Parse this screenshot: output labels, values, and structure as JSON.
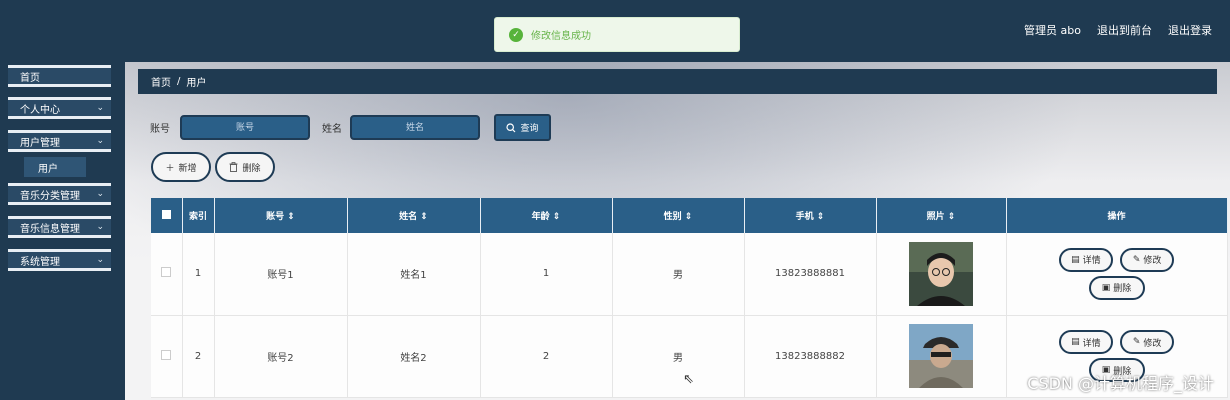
{
  "toast": {
    "message": "修改信息成功",
    "icon": "check-circle-icon",
    "color": "#67b44a"
  },
  "header": {
    "user": "管理员 abo",
    "to_front": "退出到前台",
    "logout": "退出登录"
  },
  "sidebar": {
    "items": [
      {
        "label": "首页",
        "chevron": ""
      },
      {
        "label": "个人中心",
        "chevron": "⌄"
      },
      {
        "label": "用户管理",
        "chevron": "⌄"
      },
      {
        "label": "音乐分类管理",
        "chevron": "⌄"
      },
      {
        "label": "音乐信息管理",
        "chevron": "⌄"
      },
      {
        "label": "系统管理",
        "chevron": "⌄"
      }
    ],
    "sub_item": "用户"
  },
  "breadcrumb": {
    "home": "首页",
    "sep": "/",
    "current": "用户"
  },
  "search": {
    "account_label": "账号",
    "account_placeholder": "账号",
    "name_label": "姓名",
    "name_placeholder": "姓名",
    "query_label": "查询"
  },
  "actions": {
    "add_label": "新增",
    "delete_label": "删除"
  },
  "table": {
    "headers": [
      "索引",
      "账号 ⇕",
      "姓名 ⇕",
      "年龄 ⇕",
      "性别 ⇕",
      "手机 ⇕",
      "照片 ⇕",
      "操作"
    ],
    "rows": [
      {
        "index": "1",
        "account": "账号1",
        "name": "姓名1",
        "age": "1",
        "gender": "男",
        "phone": "13823888881"
      },
      {
        "index": "2",
        "account": "账号2",
        "name": "姓名2",
        "age": "2",
        "gender": "男",
        "phone": "13823888882"
      }
    ],
    "op_detail": "详情",
    "op_edit": "修改",
    "op_delete": "删除"
  },
  "watermark": "CSDN @计算机程序_设计",
  "colors": {
    "primary": "#2a5f88",
    "dark": "#1f3a51",
    "success": "#57b33b"
  }
}
